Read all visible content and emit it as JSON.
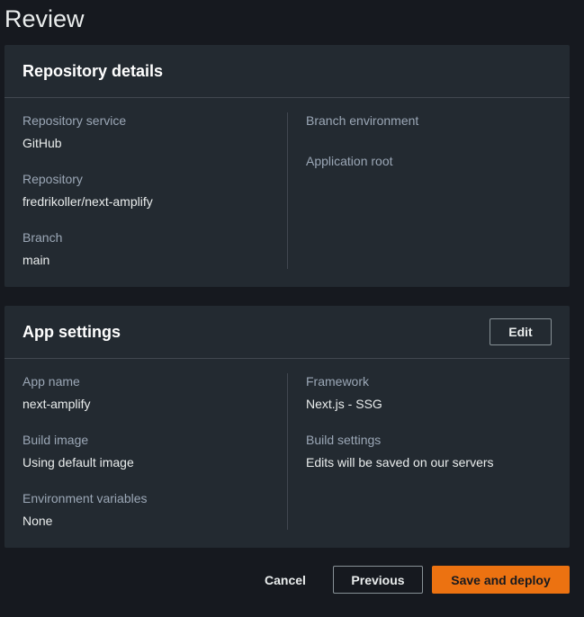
{
  "page": {
    "title": "Review"
  },
  "repository_details": {
    "title": "Repository details",
    "left": [
      {
        "label": "Repository service",
        "value": "GitHub"
      },
      {
        "label": "Repository",
        "value": "fredrikoller/next-amplify"
      },
      {
        "label": "Branch",
        "value": "main"
      }
    ],
    "right": [
      {
        "label": "Branch environment",
        "value": ""
      },
      {
        "label": "Application root",
        "value": ""
      }
    ]
  },
  "app_settings": {
    "title": "App settings",
    "edit_label": "Edit",
    "left": [
      {
        "label": "App name",
        "value": "next-amplify"
      },
      {
        "label": "Build image",
        "value": "Using default image"
      },
      {
        "label": "Environment variables",
        "value": "None"
      }
    ],
    "right": [
      {
        "label": "Framework",
        "value": "Next.js - SSG"
      },
      {
        "label": "Build settings",
        "value": "Edits will be saved on our servers"
      }
    ]
  },
  "footer": {
    "cancel_label": "Cancel",
    "previous_label": "Previous",
    "deploy_label": "Save and deploy"
  },
  "colors": {
    "background": "#16191f",
    "panel": "#232a31",
    "accent": "#ec7211"
  }
}
